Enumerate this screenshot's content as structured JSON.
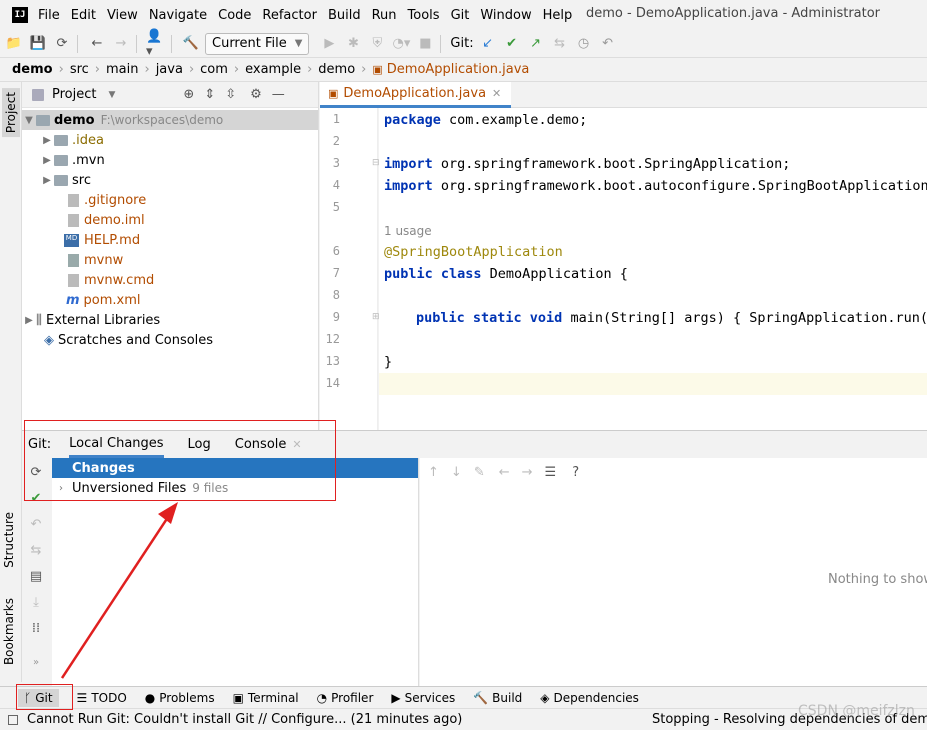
{
  "menubar": {
    "items": [
      "File",
      "Edit",
      "View",
      "Navigate",
      "Code",
      "Refactor",
      "Build",
      "Run",
      "Tools",
      "Git",
      "Window",
      "Help"
    ],
    "window_title": "demo - DemoApplication.java - Administrator"
  },
  "toolbar": {
    "run_config": "Current File",
    "git_label": "Git:"
  },
  "breadcrumb": [
    "demo",
    "src",
    "main",
    "java",
    "com",
    "example",
    "demo",
    "DemoApplication.java"
  ],
  "sidebar": {
    "project_tab": "Project",
    "structure_tab": "Structure",
    "bookmarks_tab": "Bookmarks"
  },
  "project": {
    "header": "Project",
    "root_name": "demo",
    "root_path": "F:\\workspaces\\demo",
    "items": [
      ".idea",
      ".mvn",
      "src",
      ".gitignore",
      "demo.iml",
      "HELP.md",
      "mvnw",
      "mvnw.cmd",
      "pom.xml"
    ],
    "external_libraries": "External Libraries",
    "scratches": "Scratches and Consoles"
  },
  "editor": {
    "tab": "DemoApplication.java",
    "line_numbers": [
      "1",
      "2",
      "3",
      "4",
      "5",
      "6",
      "7",
      "8",
      "9",
      "12",
      "13",
      "14"
    ],
    "line1_kw": "package",
    "line1_rest": " com.example.demo;",
    "line3_kw": "import",
    "line3_rest": " org.springframework.boot.SpringApplication;",
    "line4_kw": "import",
    "line4_rest": " org.springframework.boot.autoconfigure.SpringBootApplication;",
    "usage_hint": "1 usage",
    "line6": "@SpringBootApplication",
    "line7_kw": "public class",
    "line7_rest": " DemoApplication {",
    "line9_kw": "public static void",
    "line9_rest": " main(String[] args) { SpringApplication.run(D",
    "line13": "}"
  },
  "git": {
    "label": "Git:",
    "tabs": [
      "Local Changes",
      "Log",
      "Console"
    ],
    "changes_header": "Changes",
    "unversioned_label": "Unversioned Files",
    "unversioned_count": "9 files",
    "empty_text": "Nothing to show"
  },
  "bottom_tools": [
    "Git",
    "TODO",
    "Problems",
    "Terminal",
    "Profiler",
    "Services",
    "Build",
    "Dependencies"
  ],
  "status": {
    "left": "Cannot Run Git: Couldn't install Git // Configure... (21 minutes ago)",
    "right": "Stopping - Resolving dependencies of demo..."
  },
  "watermark": "CSDN @meifzlzn",
  "colors": {
    "accent": "#4083c9",
    "selection": "#2675bf",
    "keyword": "#0033b3",
    "filename_modified": "#b24c00",
    "highlight_box": "#e02020"
  }
}
